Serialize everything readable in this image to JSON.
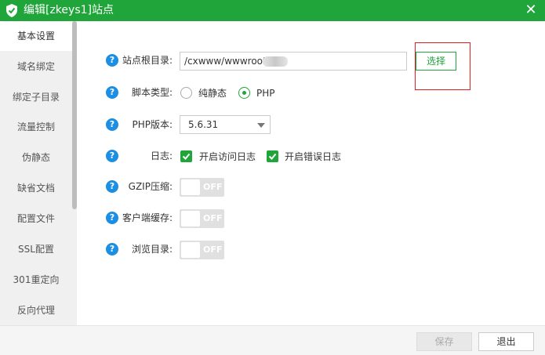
{
  "window": {
    "title": "编辑[zkeys1]站点",
    "logo_icon": "shield-icon",
    "close_glyph": "✕",
    "accent_color": "#20a53a"
  },
  "sidebar": {
    "items": [
      {
        "label": "基本设置",
        "active": true
      },
      {
        "label": "域名绑定"
      },
      {
        "label": "绑定子目录"
      },
      {
        "label": "流量控制"
      },
      {
        "label": "伪静态"
      },
      {
        "label": "缺省文档"
      },
      {
        "label": "配置文件"
      },
      {
        "label": "SSL配置"
      },
      {
        "label": "301重定向"
      },
      {
        "label": "反向代理"
      }
    ]
  },
  "form": {
    "help_glyph": "?",
    "site_root": {
      "label": "站点根目录:",
      "value": "/cxwww/wwwroot/",
      "choose_label": "选择"
    },
    "script_type": {
      "label": "脚本类型:",
      "options": [
        "纯静态",
        "PHP"
      ],
      "selected": "PHP"
    },
    "php_version": {
      "label": "PHP版本:",
      "value": "5.6.31"
    },
    "log": {
      "label": "日志:",
      "options": [
        "开启访问日志",
        "开启错误日志"
      ],
      "checked": [
        true,
        true
      ]
    },
    "gzip": {
      "label": "GZIP压缩:",
      "state": "OFF"
    },
    "client_cache": {
      "label": "客户端缓存:",
      "state": "OFF"
    },
    "browse_dir": {
      "label": "浏览目录:",
      "state": "OFF"
    }
  },
  "footer": {
    "save_label": "保存",
    "exit_label": "退出"
  }
}
